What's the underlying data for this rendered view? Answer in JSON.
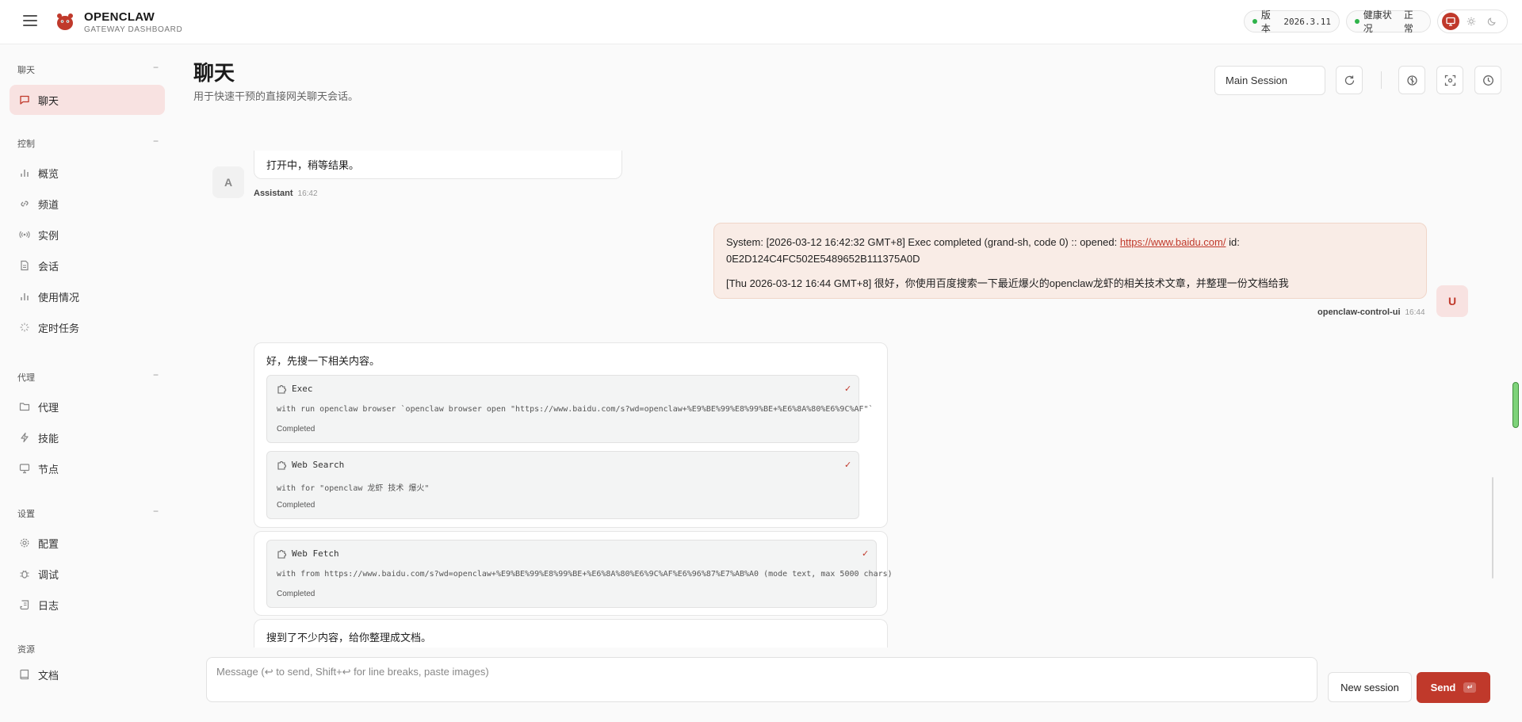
{
  "brand": {
    "name": "OPENCLAW",
    "subtitle": "GATEWAY DASHBOARD"
  },
  "header": {
    "version_label": "版本",
    "version_value": "2026.3.11",
    "health_label": "健康状况",
    "health_value": "正常",
    "accent": "#c0392b"
  },
  "sidebar": {
    "sections": [
      {
        "title": "聊天",
        "items": [
          {
            "label": "聊天",
            "icon": "chat-bubble-icon",
            "active": true
          }
        ]
      },
      {
        "title": "控制",
        "items": [
          {
            "label": "概览",
            "icon": "bar-chart-icon"
          },
          {
            "label": "频道",
            "icon": "link-icon"
          },
          {
            "label": "实例",
            "icon": "broadcast-icon"
          },
          {
            "label": "会话",
            "icon": "document-icon"
          },
          {
            "label": "使用情况",
            "icon": "bar-chart-icon"
          },
          {
            "label": "定时任务",
            "icon": "loader-icon"
          }
        ]
      },
      {
        "title": "代理",
        "items": [
          {
            "label": "代理",
            "icon": "folder-icon"
          },
          {
            "label": "技能",
            "icon": "lightning-icon"
          },
          {
            "label": "节点",
            "icon": "monitor-icon"
          }
        ]
      },
      {
        "title": "设置",
        "items": [
          {
            "label": "配置",
            "icon": "gear-icon"
          },
          {
            "label": "调试",
            "icon": "bug-icon"
          },
          {
            "label": "日志",
            "icon": "scroll-icon"
          }
        ]
      },
      {
        "title": "资源",
        "items": [
          {
            "label": "文档",
            "icon": "book-icon"
          }
        ]
      }
    ],
    "collapse_glyph": "−"
  },
  "page": {
    "title": "聊天",
    "subtitle": "用于快速干预的直接网关聊天会话。",
    "session_select": "Main Session"
  },
  "messages": {
    "m1": {
      "avatar": "A",
      "text": "打开中，稍等结果。",
      "sender": "Assistant",
      "time": "16:42"
    },
    "m2": {
      "avatar": "U",
      "line1_prefix": "System: [2026-03-12 16:42:32 GMT+8] Exec completed (grand-sh, code 0) :: opened: ",
      "link": "https://www.baidu.com/",
      "line1_suffix": " id:",
      "line2": "0E2D124C4FC502E5489652B111375A0D",
      "line3": "[Thu 2026-03-12 16:44 GMT+8] 很好，你使用百度搜索一下最近爆火的openclaw龙虾的相关技术文章，并整理一份文档给我",
      "sender": "openclaw-control-ui",
      "time": "16:44"
    },
    "m3": {
      "text": "好，先搜一下相关内容。",
      "tools": [
        {
          "name": "Exec",
          "detail": "with run openclaw browser `openclaw browser open \"https://www.baidu.com/s?wd=openclaw+%E9%BE%99%E8%99%BE+%E6%8A%80%E6%9C%AF\"`",
          "status": "Completed",
          "check": "✓"
        },
        {
          "name": "Web Search",
          "detail": "with for \"openclaw 龙虾 技术 爆火\"",
          "status": "Completed",
          "check": "✓"
        }
      ]
    },
    "m4": {
      "tools": [
        {
          "name": "Web Fetch",
          "detail": "with from https://www.baidu.com/s?wd=openclaw+%E9%BE%99%E8%99%BE+%E6%8A%80%E6%9C%AF%E6%96%87%E7%AB%A0 (mode text, max 5000 chars)",
          "status": "Completed",
          "check": "✓"
        }
      ]
    },
    "m5": {
      "text": "搜到了不少内容，给你整理成文档。"
    }
  },
  "composer": {
    "placeholder": "Message (↩ to send, Shift+↩ for line breaks, paste images)",
    "new_session": "New session",
    "send": "Send",
    "send_kbd": "↵"
  }
}
